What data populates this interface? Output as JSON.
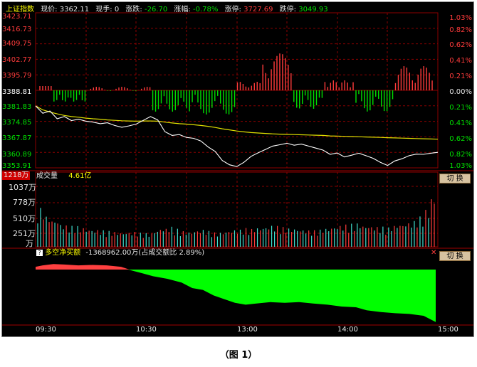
{
  "header": {
    "index_name": "上证指数",
    "price_label": "现价:",
    "price": "3362.11",
    "volume_label": "现手:",
    "volume": "0",
    "change_label": "涨跌:",
    "change": "-26.70",
    "pct_label": "涨幅:",
    "pct": "-0.78%",
    "limit_up_label": "涨停:",
    "limit_up": "3727.69",
    "limit_down_label": "跌停:",
    "limit_down": "3049.93"
  },
  "price_axis_left": [
    "3423.71",
    "3416.73",
    "3409.75",
    "3402.77",
    "3395.79",
    "3388.81",
    "3381.83",
    "3374.85",
    "3367.87",
    "3360.89",
    "3353.91"
  ],
  "price_axis_right": [
    "1.03%",
    "0.82%",
    "0.62%",
    "0.41%",
    "0.21%",
    "0.00%",
    "0.21%",
    "0.41%",
    "0.62%",
    "0.82%",
    "1.03%"
  ],
  "volume_panel": {
    "title": "成交量",
    "total": "4.61亿",
    "max_label": "1218万",
    "axis": [
      "1037万",
      "778万",
      "510万",
      "251万",
      "万"
    ],
    "switch_button": "切 换"
  },
  "net_buy_panel": {
    "help_icon": "?",
    "title": "多空净买额",
    "value": "-1368962.00万(占成交额比 2.89%)",
    "close_icon": "✕",
    "switch_button": "切 换"
  },
  "time_axis": [
    "09:30",
    "10:30",
    "13:00",
    "14:00",
    "15:00"
  ],
  "caption": "（图 1）",
  "colors": {
    "up": "#ff3b3b",
    "down": "#00e000",
    "price_line": "#ffffff",
    "avg_line": "#e0e000",
    "grid": "#8b0000",
    "background": "#000000"
  },
  "chart_data": {
    "type": "line",
    "title": "上证指数",
    "x_range": [
      "09:30",
      "15:00"
    ],
    "ylim": [
      3353.91,
      3423.71
    ],
    "series": [
      {
        "name": "price",
        "values": [
          3381.8,
          3378.5,
          3379.5,
          3376.0,
          3377.0,
          3375.2,
          3375.8,
          3374.9,
          3374.5,
          3373.8,
          3374.2,
          3373.0,
          3372.2,
          3372.8,
          3373.6,
          3375.3,
          3377.0,
          3375.5,
          3370.2,
          3368.5,
          3368.9,
          3367.6,
          3367.2,
          3366.0,
          3363.4,
          3361.3,
          3357.2,
          3355.3,
          3354.5,
          3356.4,
          3359.1,
          3360.7,
          3362.2,
          3363.7,
          3364.3,
          3365.0,
          3364.1,
          3364.6,
          3363.7,
          3362.8,
          3361.9,
          3360.0,
          3360.6,
          3358.8,
          3359.6,
          3360.5,
          3359.4,
          3358.2,
          3356.4,
          3355.0,
          3357.0,
          3358.0,
          3359.4,
          3360.1,
          3360.0,
          3360.5,
          3360.9
        ]
      },
      {
        "name": "average",
        "values": [
          3381.8,
          3380.0,
          3379.0,
          3378.2,
          3377.5,
          3377.0,
          3376.7,
          3376.3,
          3376.0,
          3375.8,
          3375.5,
          3375.3,
          3375.1,
          3375.0,
          3374.9,
          3375.0,
          3375.0,
          3374.9,
          3374.5,
          3374.1,
          3373.8,
          3373.6,
          3373.3,
          3373.0,
          3372.6,
          3372.1,
          3371.5,
          3371.0,
          3370.5,
          3370.1,
          3369.8,
          3369.6,
          3369.4,
          3369.2,
          3369.1,
          3369.0,
          3368.9,
          3368.8,
          3368.7,
          3368.6,
          3368.5,
          3368.3,
          3368.2,
          3368.1,
          3368.0,
          3367.9,
          3367.8,
          3367.7,
          3367.6,
          3367.5,
          3367.4,
          3367.3,
          3367.2,
          3367.1,
          3367.0,
          3366.9,
          3366.8
        ]
      }
    ],
    "volume_max_wan": 1218,
    "volume_values_wan": [
      540,
      430,
      380,
      320,
      300,
      290,
      270,
      250,
      240,
      230,
      220,
      210,
      200,
      205,
      210,
      195,
      190,
      230,
      260,
      280,
      250,
      220,
      210,
      230,
      240,
      220,
      200,
      215,
      230,
      240,
      260,
      250,
      270,
      280,
      300,
      290,
      275,
      260,
      250,
      240,
      230,
      240,
      260,
      280,
      300,
      310,
      320,
      330,
      300,
      290,
      280,
      270,
      300,
      320,
      340,
      360,
      420,
      520,
      700
    ],
    "net_buy": {
      "x_points": [
        "09:30",
        "09:50",
        "10:15",
        "10:30",
        "11:00",
        "11:20",
        "13:00",
        "13:30",
        "14:00",
        "14:30",
        "15:00"
      ],
      "values": [
        0.3,
        0.5,
        0.2,
        -0.05,
        -0.3,
        -0.55,
        -0.9,
        -0.8,
        -0.9,
        -1.0,
        -1.25
      ]
    }
  }
}
